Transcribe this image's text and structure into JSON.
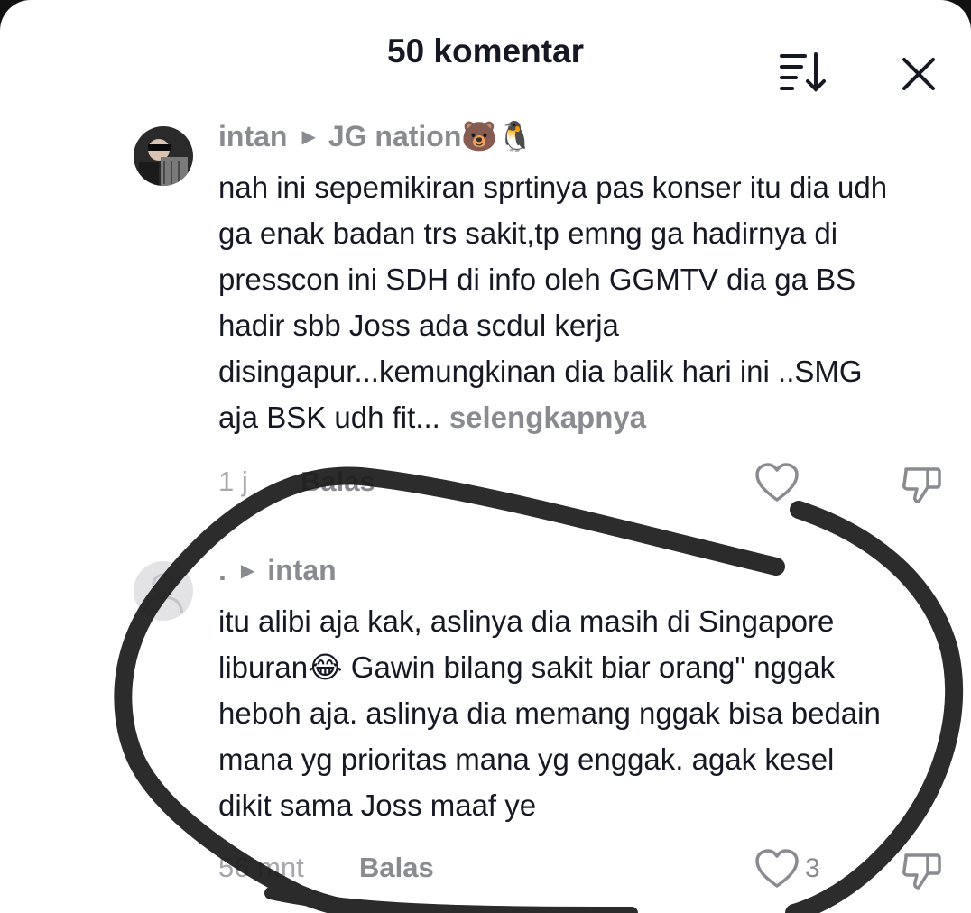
{
  "header": {
    "title": "50 komentar"
  },
  "icons": {
    "sort": "sort-descending-icon",
    "close": "close-icon",
    "like": "heart-icon",
    "dislike": "thumbs-down-icon",
    "reply_arrow": "play-triangle-icon"
  },
  "comments": [
    {
      "author": "intan",
      "reply_to": "JG nation🐻🐧",
      "text": "nah ini sepemikiran sprtinya pas konser itu dia udh\nga enak badan trs sakit,tp emng ga hadirnya di\npresscon ini SDH di info oleh GGMTV dia ga BS\nhadir sbb Joss ada scdul kerja\ndisingapur...kemungkinan dia balik hari ini ..SMG\naja BSK udh fit...",
      "more": "selengkapnya",
      "time": "1 j",
      "reply_label": "Balas",
      "likes": ""
    },
    {
      "author": ".",
      "reply_to": "intan",
      "text": "itu alibi aja kak, aslinya dia masih di Singapore\nliburan😂 Gawin bilang sakit biar orang\" nggak\nheboh aja. aslinya dia memang nggak bisa bedain\nmana yg prioritas mana yg enggak. agak kesel\ndikit sama Joss maaf ye",
      "time": "56 mnt",
      "reply_label": "Balas",
      "likes": "3"
    }
  ],
  "colors": {
    "primary_text": "#161823",
    "secondary_text": "#8a8b91",
    "background": "#ffffff",
    "annotation_stroke": "#1a1a1a"
  }
}
